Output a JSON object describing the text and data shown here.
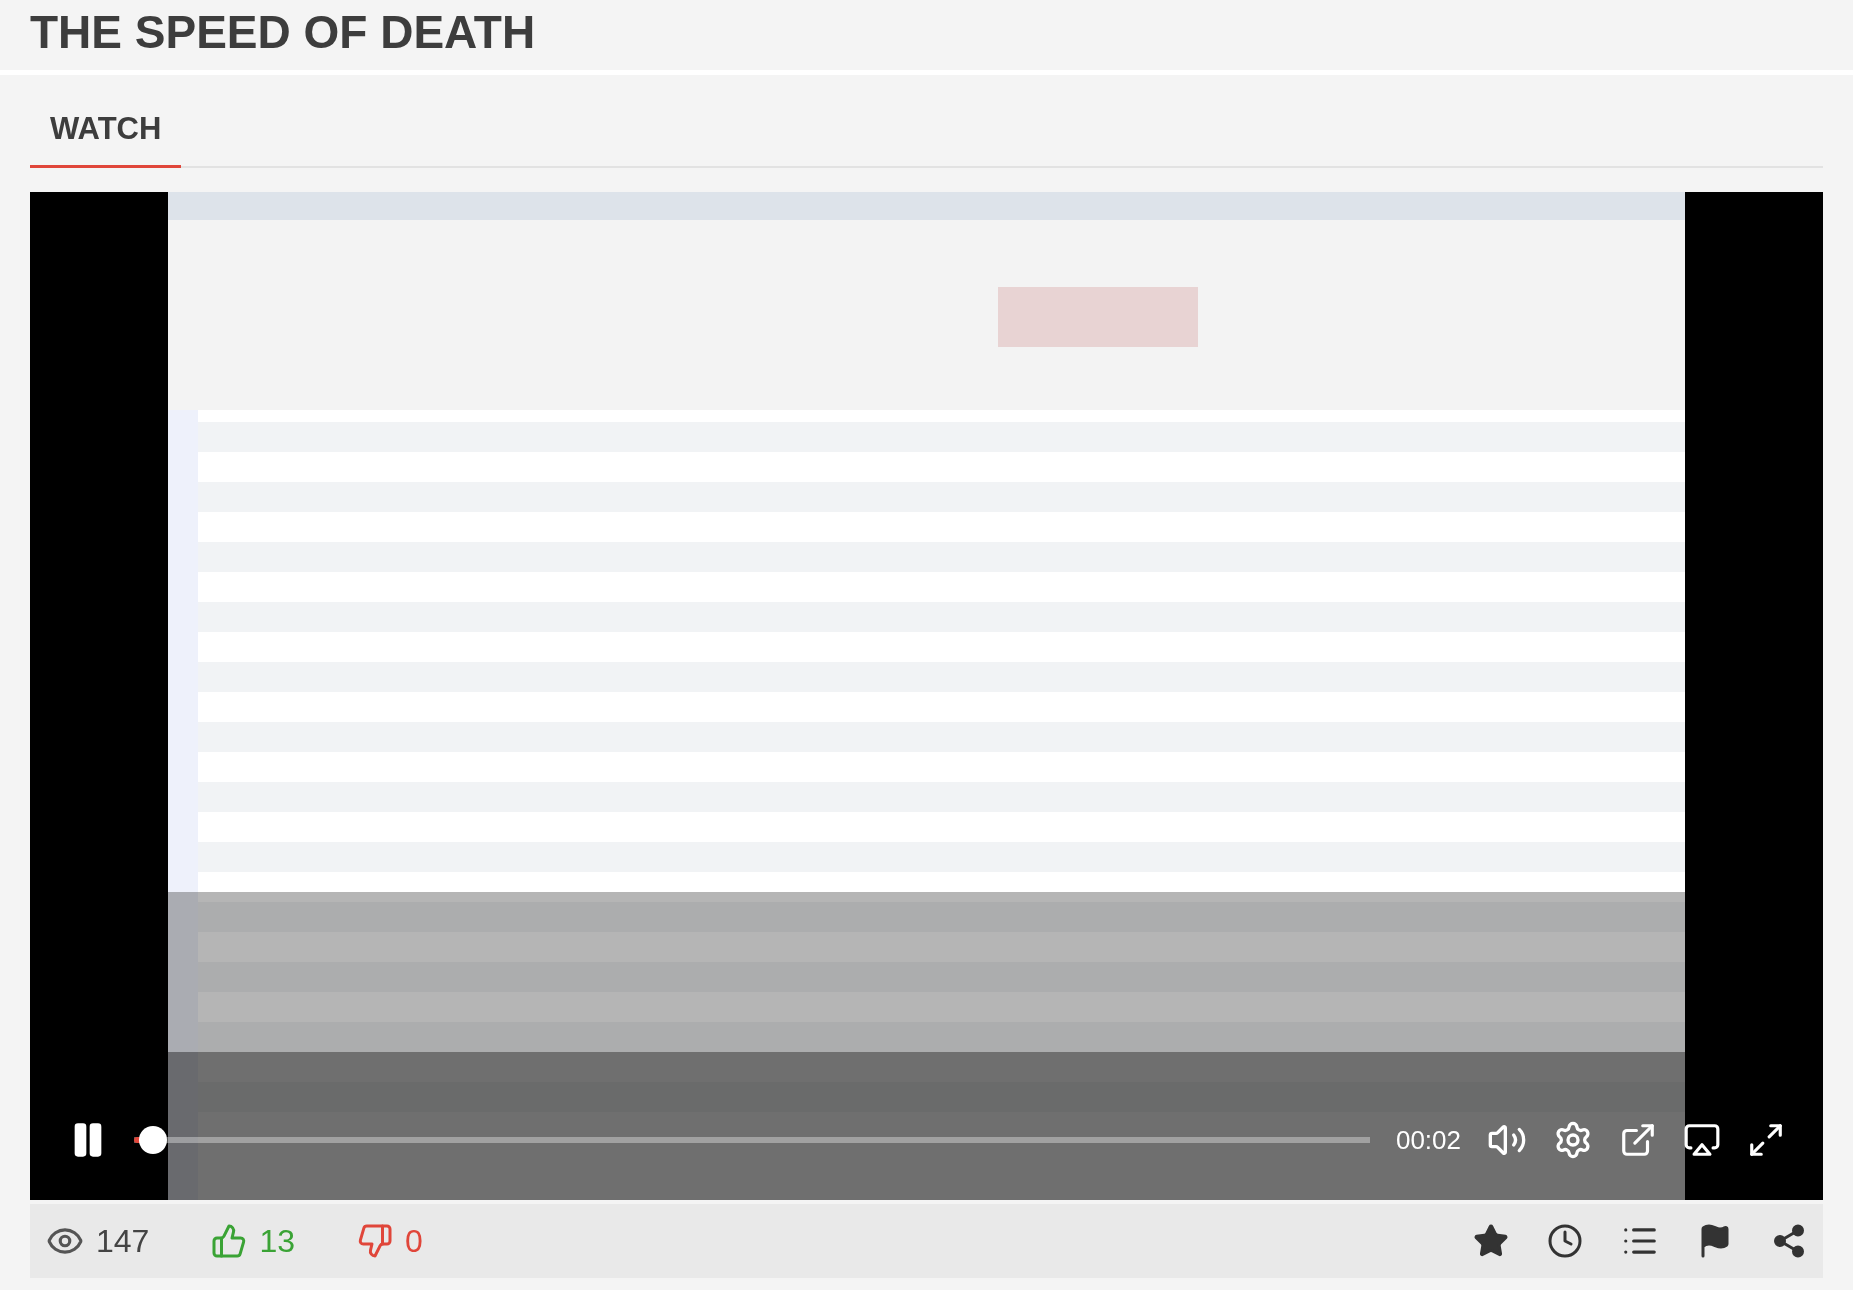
{
  "page_title": "THE SPEED OF DEATH",
  "tabs": [
    {
      "label": "WATCH",
      "selected": true
    }
  ],
  "video": {
    "kind": "picture",
    "playing": true,
    "time": "00:02",
    "level": 0.015
  },
  "stats": {
    "views": "147",
    "likes": "13",
    "dislikes": "0"
  }
}
